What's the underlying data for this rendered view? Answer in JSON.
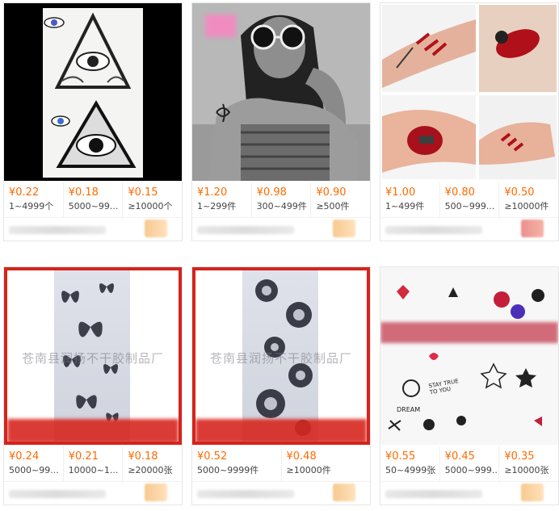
{
  "products": [
    {
      "tiers": [
        {
          "price": "¥0.22",
          "qty": "1~4999个"
        },
        {
          "price": "¥0.18",
          "qty": "5000~99..."
        },
        {
          "price": "¥0.15",
          "qty": "≥10000个"
        }
      ]
    },
    {
      "tiers": [
        {
          "price": "¥1.20",
          "qty": "1~299件"
        },
        {
          "price": "¥0.98",
          "qty": "300~499件"
        },
        {
          "price": "¥0.90",
          "qty": "≥500件"
        }
      ]
    },
    {
      "tiers": [
        {
          "price": "¥1.00",
          "qty": "1~499件"
        },
        {
          "price": "¥0.80",
          "qty": "500~999..."
        },
        {
          "price": "¥0.50",
          "qty": "≥10000件"
        }
      ]
    },
    {
      "watermark": "苍南县润扬不干胶制品厂",
      "tiers": [
        {
          "price": "¥0.24",
          "qty": "5000~99..."
        },
        {
          "price": "¥0.21",
          "qty": "10000~1..."
        },
        {
          "price": "¥0.18",
          "qty": "≥20000张"
        }
      ]
    },
    {
      "watermark": "苍南县润扬不干胶制品厂",
      "tiers": [
        {
          "price": "¥0.52",
          "qty": "5000~9999件"
        },
        {
          "price": "¥0.48",
          "qty": "≥10000件"
        }
      ]
    },
    {
      "tiers": [
        {
          "price": "¥0.55",
          "qty": "50~4999张"
        },
        {
          "price": "¥0.45",
          "qty": "5000~999..."
        },
        {
          "price": "¥0.35",
          "qty": "≥10000张"
        }
      ]
    }
  ],
  "colors": {
    "price": "#ff6a00",
    "frame": "#d4241c"
  },
  "image6_text": {
    "stay_true": "STAY TRUE TO YOU",
    "dream": "DREAM"
  }
}
